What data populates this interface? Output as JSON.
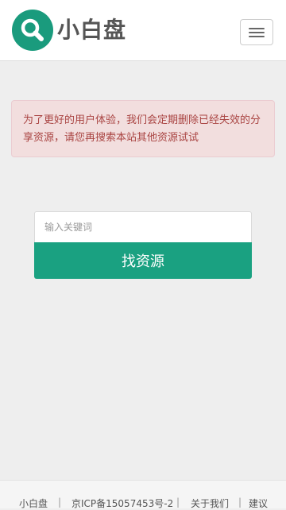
{
  "header": {
    "brand": "小白盘",
    "menu_icon": "hamburger-menu-icon",
    "logo_icon": "search-icon"
  },
  "alert": {
    "message": "为了更好的用户体验，我们会定期删除已经失效的分享资源，请您再搜索本站其他资源试试"
  },
  "search": {
    "placeholder": "输入关键词",
    "value": "",
    "button_label": "找资源"
  },
  "footer": {
    "items": [
      "小白盘",
      "京ICP备15057453号-2",
      "关于我们",
      "建议"
    ],
    "separator": "|"
  },
  "colors": {
    "brand_green": "#1a9b7d",
    "alert_bg": "#f2dede",
    "alert_text": "#a94442",
    "button_bg": "#1aa181"
  }
}
